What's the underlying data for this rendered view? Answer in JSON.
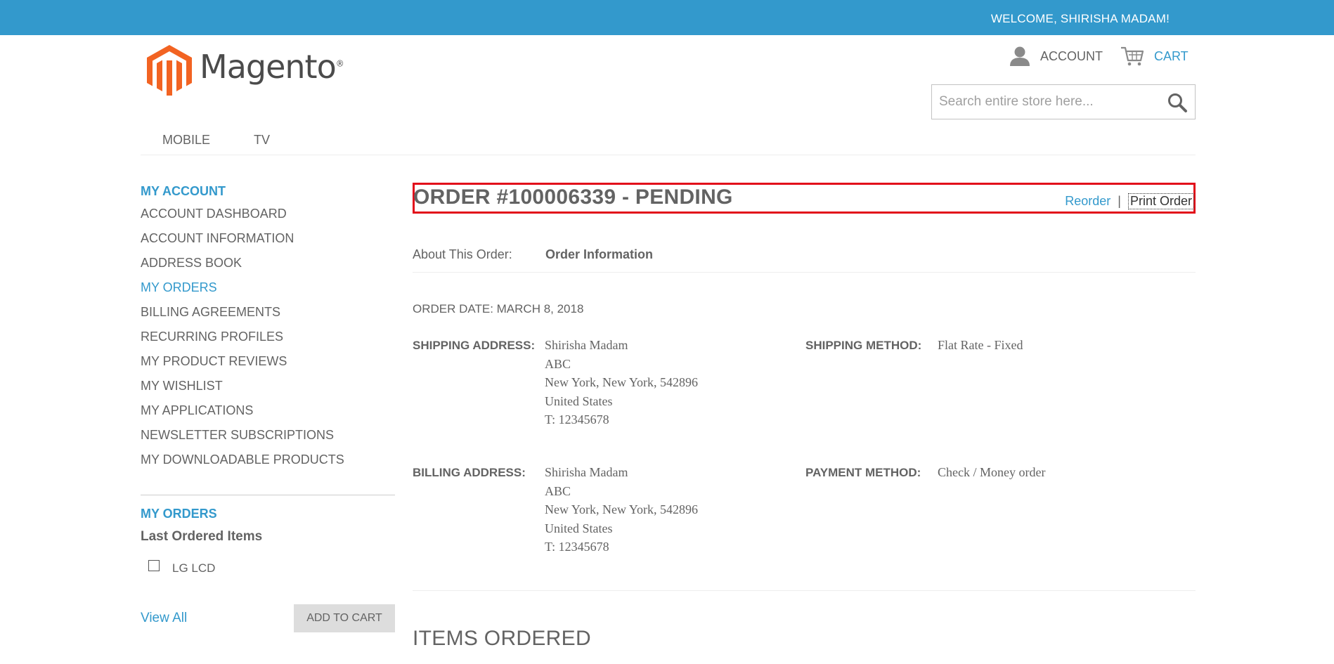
{
  "topbar": {
    "welcome": "WELCOME, SHIRISHA MADAM!",
    "color": "#3399cc"
  },
  "logo": {
    "text": "Magento",
    "reg": "®",
    "colors": [
      "#f26322",
      "#4b4b4b"
    ]
  },
  "header": {
    "account_label": "ACCOUNT",
    "cart_label": "CART"
  },
  "search": {
    "placeholder": "Search entire store here..."
  },
  "nav": {
    "items": [
      "MOBILE",
      "TV"
    ]
  },
  "sidebar": {
    "title": "MY ACCOUNT",
    "items": [
      {
        "label": "ACCOUNT DASHBOARD"
      },
      {
        "label": "ACCOUNT INFORMATION"
      },
      {
        "label": "ADDRESS BOOK"
      },
      {
        "label": "MY ORDERS"
      },
      {
        "label": "BILLING AGREEMENTS"
      },
      {
        "label": "RECURRING PROFILES"
      },
      {
        "label": "MY PRODUCT REVIEWS"
      },
      {
        "label": "MY WISHLIST"
      },
      {
        "label": "MY APPLICATIONS"
      },
      {
        "label": "NEWSLETTER SUBSCRIPTIONS"
      },
      {
        "label": "MY DOWNLOADABLE PRODUCTS"
      }
    ],
    "active_index": 3,
    "my_orders": {
      "title": "MY ORDERS",
      "last_ordered_title": "Last Ordered Items",
      "item_name": "LG LCD",
      "view_all": "View All",
      "add_to_cart": "ADD TO CART"
    }
  },
  "order": {
    "title": "ORDER #100006339 - PENDING",
    "reorder": "Reorder",
    "separator": "|",
    "print_order": "Print Order",
    "about_label": "About This Order:",
    "about_info": "Order Information",
    "order_date": "ORDER DATE: MARCH 8, 2018",
    "shipping_address_label": "SHIPPING ADDRESS:",
    "shipping_address": [
      "Shirisha Madam",
      "ABC",
      "New York, New York, 542896",
      "United States",
      "T: 12345678"
    ],
    "shipping_method_label": "SHIPPING METHOD:",
    "shipping_method": "Flat Rate - Fixed",
    "billing_address_label": "BILLING ADDRESS:",
    "billing_address": [
      "Shirisha Madam",
      "ABC",
      "New York, New York, 542896",
      "United States",
      "T: 12345678"
    ],
    "payment_method_label": "PAYMENT METHOD:",
    "payment_method": "Check / Money order",
    "items_ordered_title": "ITEMS ORDERED"
  },
  "colors": {
    "accent": "#3399cc",
    "highlight_border": "#e20c1a",
    "text": "#636363"
  }
}
